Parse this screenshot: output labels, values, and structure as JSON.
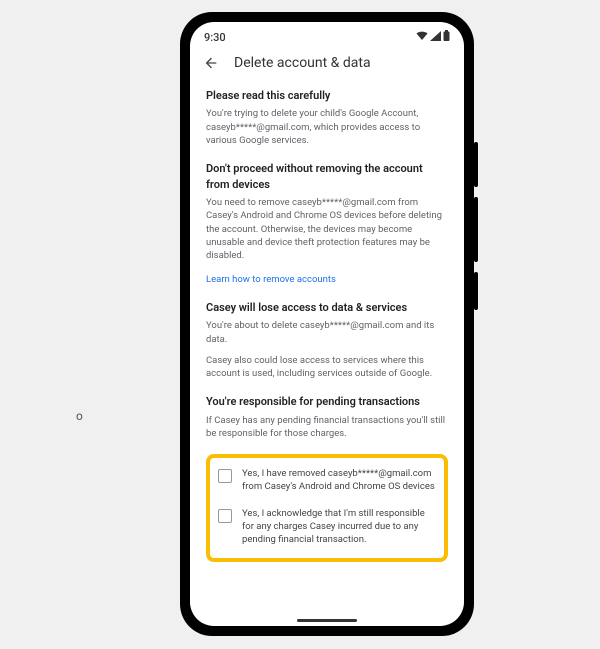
{
  "stray": "o",
  "status": {
    "time": "9:30"
  },
  "header": {
    "title": "Delete account & data"
  },
  "sections": {
    "careful": {
      "title": "Please read this carefully",
      "body": "You're trying to delete your child's Google Account, caseyb*****@gmail.com, which provides access to various Google services."
    },
    "dont_proceed": {
      "title": "Don't proceed without removing the account from devices",
      "body": "You need to remove caseyb*****@gmail.com from Casey's Android and Chrome OS devices before deleting the account. Otherwise, the devices may become unusable and device theft protection features may be disabled.",
      "link": "Learn how to remove accounts"
    },
    "lose_access": {
      "title": "Casey will lose access to data & services",
      "body1": "You're about to delete caseyb*****@gmail.com and its data.",
      "body2": "Casey also could lose access to services where this account is used, including services outside of Google."
    },
    "pending": {
      "title": "You're responsible for pending transactions",
      "body": "If Casey has any pending financial transactions you'll still be responsible for those charges."
    }
  },
  "checkboxes": {
    "removed": "Yes, I have removed caseyb*****@gmail.com from Casey's Android and Chrome OS devices",
    "acknowledge": "Yes, I acknowledge that I'm still responsible for any charges Casey incurred due to any pending financial transaction."
  }
}
